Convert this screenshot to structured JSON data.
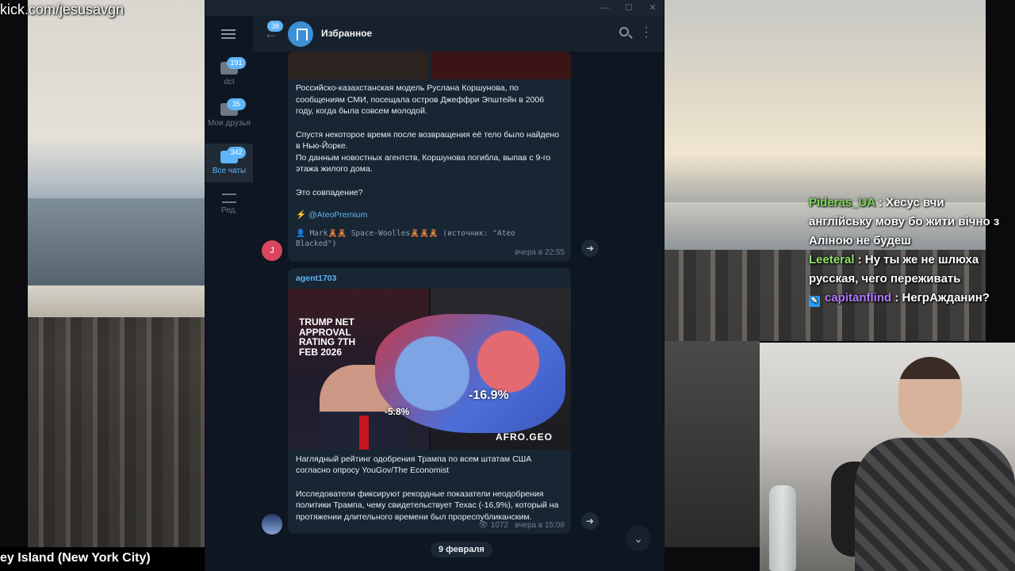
{
  "stream": {
    "url": "kick.com/jesusavgn",
    "location": "ey Island (New York City)",
    "chat": [
      {
        "name": "Pideras_UA",
        "text": ": Хесус вчи англійську мову бо жити вічно з Аліною не будеш"
      },
      {
        "name": "Leeteral",
        "text": ": Ну ты же не шлюха русская, чего переживать"
      },
      {
        "name": "capitanflind",
        "text": ": НегрАжданин?"
      }
    ]
  },
  "telegram": {
    "folders": [
      {
        "label": "dct",
        "badge": "191"
      },
      {
        "label": "Мои друзья",
        "badge": "35"
      },
      {
        "label": "Все чаты",
        "badge": "342"
      },
      {
        "label": "Ред.",
        "badge": ""
      }
    ],
    "header": {
      "back_badge": "38",
      "title": "Избранное"
    },
    "message1": {
      "para1": "Российско-казахстанская модель Руслана Коршунова, по сообщениям СМИ, посещала остров Джеффри Эпштейн в 2006 году, когда была совсем молодой.",
      "para2": "Спустя некоторое время после возвращения её тело было найдено в Нью-Йорке.",
      "para3": "По данным новостных агентств, Коршунова погибла, выпав с 9-го этажа жилого дома.",
      "para4": "Это совпадение?",
      "link": "@AteoPremium",
      "signature": "Mark🧸🧸 Space-Woolles🧸🧸🧸 (источник: \"Ateo Blacked\")",
      "time": "вчера в 22:55",
      "avatar_letter": "J"
    },
    "message2": {
      "sender": "agent1703",
      "image": {
        "headline": "TRUMP NET APPROVAL RATING 7TH FEB 2026",
        "big_value": "-16.9%",
        "small_value": "-5.8%",
        "brand": "AFRO.GEO"
      },
      "para1": "Наглядный рейтинг одобрения Трампа по всем штатам США согласно опросу YouGov/The Economist",
      "para2": "Исследователи фиксируют рекордные показатели неодобрения политики Трампа, чему свидетельствует Техас (-16,9%), который на протяжении длительного времени был прореспубликанским.",
      "views": "1072",
      "time": "вчера в 15:08"
    },
    "date_separator": "9 февраля"
  },
  "colors": {
    "accent": "#5eb5f7",
    "bubble": "#182533",
    "window": "#0e1621",
    "header": "#17212b"
  }
}
